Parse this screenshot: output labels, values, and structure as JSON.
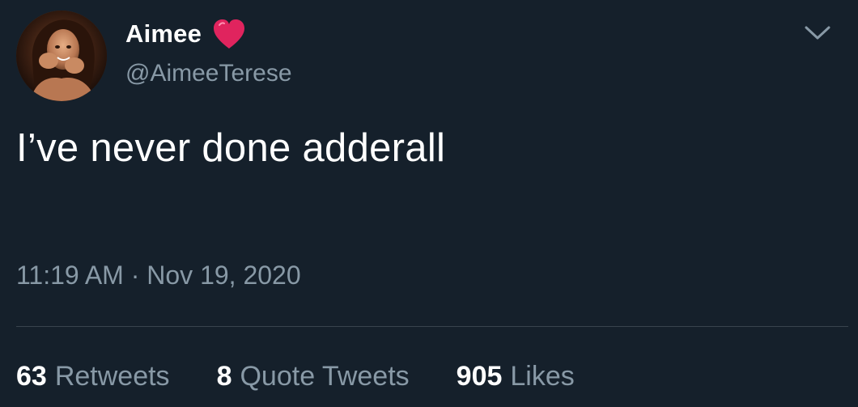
{
  "author": {
    "display_name": "Aimee",
    "handle": "@AimeeTerese",
    "name_emoji": "heart-icon"
  },
  "tweet": {
    "text": "I’ve never done adderall",
    "time": "11:19 AM",
    "separator": "·",
    "date": "Nov 19, 2020"
  },
  "stats": {
    "retweets_count": "63",
    "retweets_label": "Retweets",
    "quote_tweets_count": "8",
    "quote_tweets_label": "Quote Tweets",
    "likes_count": "905",
    "likes_label": "Likes"
  },
  "colors": {
    "background": "#15202b",
    "primary_text": "#ffffff",
    "secondary_text": "#8899a6",
    "divider": "#38444d",
    "heart": "#e0245e"
  },
  "icons": {
    "menu": "chevron-down-icon"
  }
}
